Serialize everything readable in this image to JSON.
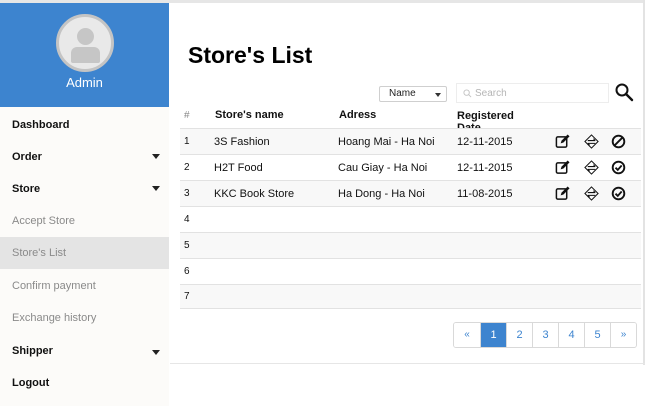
{
  "profile": {
    "name": "Admin"
  },
  "sidebar": {
    "items": [
      {
        "label": "Dashboard"
      },
      {
        "label": "Order"
      },
      {
        "label": "Store"
      },
      {
        "label": "Accept Store"
      },
      {
        "label": "Store's List"
      },
      {
        "label": "Confirm payment"
      },
      {
        "label": "Exchange history"
      },
      {
        "label": "Shipper"
      },
      {
        "label": "Logout"
      }
    ]
  },
  "main": {
    "title": "Store's List",
    "sort_select": {
      "value": "Name"
    },
    "search": {
      "placeholder": "Search"
    },
    "table": {
      "headers": {
        "num": "#",
        "name": "Store's name",
        "address": "Adress",
        "registered": "Registered Date"
      },
      "rows": [
        {
          "num": "1",
          "name": "3S Fashion",
          "address": "Hoang Mai - Ha Noi",
          "date": "12-11-2015",
          "status_icon": "block-icon"
        },
        {
          "num": "2",
          "name": "H2T Food",
          "address": "Cau Giay - Ha Noi",
          "date": "12-11-2015",
          "status_icon": "check-circle-icon"
        },
        {
          "num": "3",
          "name": "KKC Book Store",
          "address": "Ha Dong - Ha Noi",
          "date": "11-08-2015",
          "status_icon": "check-circle-icon"
        },
        {
          "num": "4",
          "name": "",
          "address": "",
          "date": ""
        },
        {
          "num": "5",
          "name": "",
          "address": "",
          "date": ""
        },
        {
          "num": "6",
          "name": "",
          "address": "",
          "date": ""
        },
        {
          "num": "7",
          "name": "",
          "address": "",
          "date": ""
        }
      ]
    },
    "pagination": {
      "prev": "«",
      "pages": [
        "1",
        "2",
        "3",
        "4",
        "5"
      ],
      "current": "1",
      "next": "»"
    }
  },
  "colors": {
    "accent": "#3d84cf",
    "active_nav": "#e4e4e4",
    "row_alt": "#f8f8f8"
  }
}
